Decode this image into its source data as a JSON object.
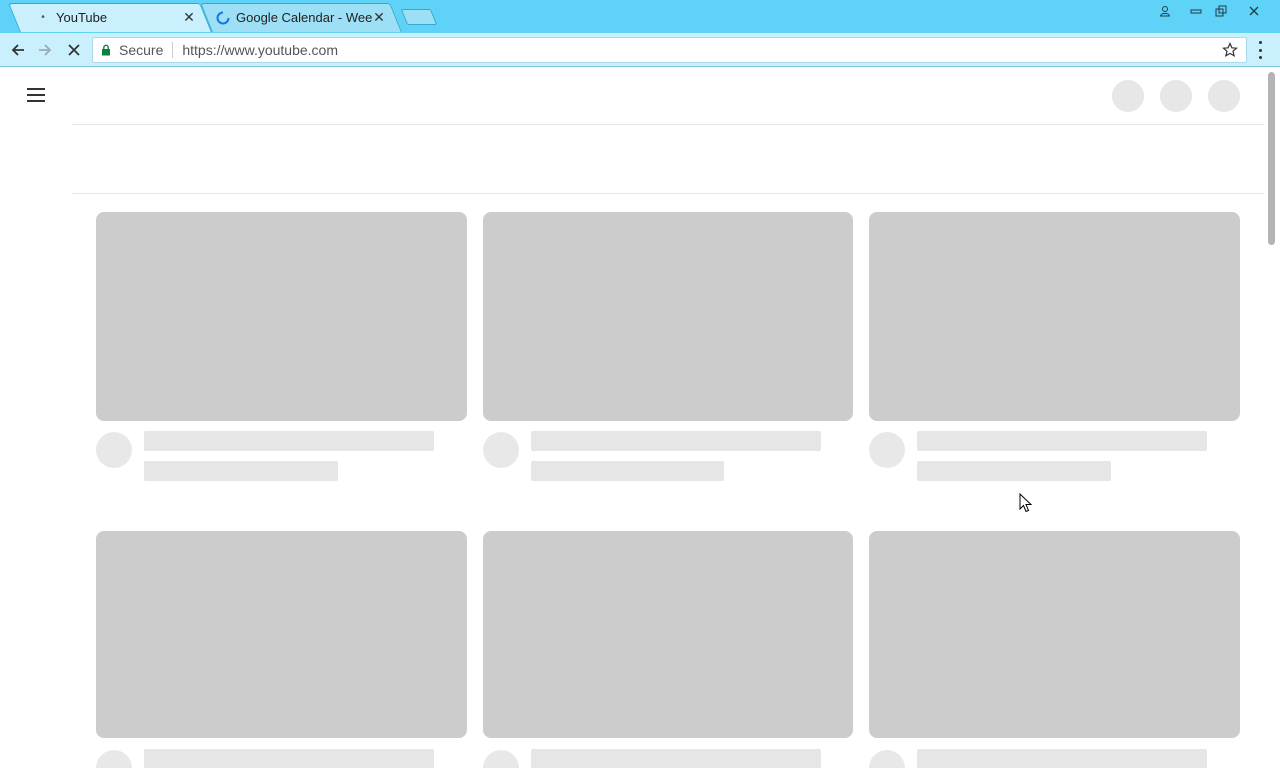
{
  "browser": {
    "tabs": [
      {
        "title": "YouTube",
        "favicon": "loading-dot",
        "active": true
      },
      {
        "title": "Google Calendar - Week",
        "favicon": "loading-spinner-icon",
        "active": false
      }
    ],
    "omnibox": {
      "security_label": "Secure",
      "url": "https://www.youtube.com"
    },
    "colors": {
      "frame": "#5fd3f7",
      "toolbar": "#c9f0fc",
      "lock": "#0b8043"
    }
  },
  "page": {
    "skeleton_cards_rows": 2,
    "skeleton_cards_per_row": 3,
    "colors": {
      "placeholder_thumb": "#cccccc",
      "placeholder_text": "#e6e6e6"
    }
  }
}
